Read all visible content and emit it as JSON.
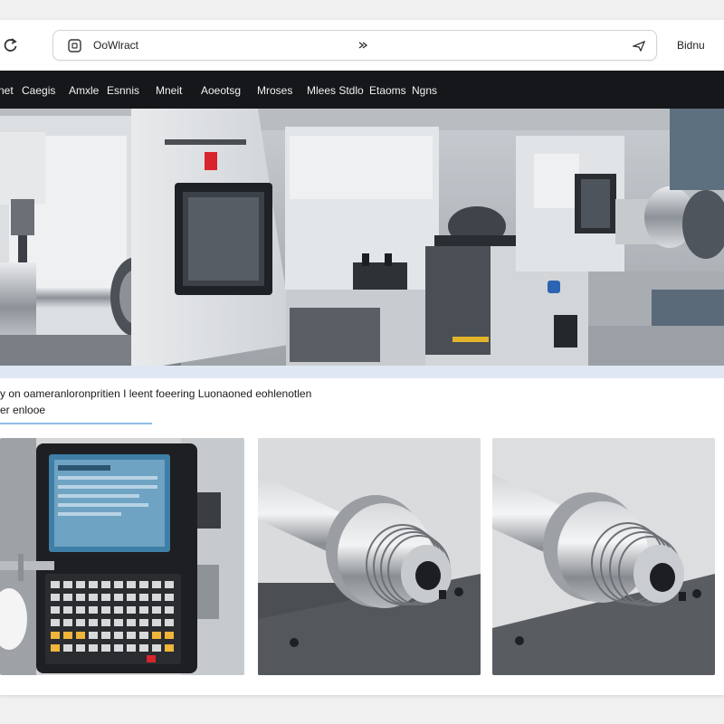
{
  "browser": {
    "url_text": "OoWlract",
    "right_label": "Bidnu"
  },
  "nav": {
    "items": [
      "net",
      "Caegis",
      "Amxle",
      "Esnnis",
      "Mneit",
      "Aoeotsg",
      "Mroses",
      "Mlees Stdlo",
      "Etaoms",
      "Ngns"
    ]
  },
  "hero": {
    "alt": "CNC machining workshop with lathes"
  },
  "caption": {
    "line1": "y on oameranloronpritien I leent foeering Luonaoned eohlenotlen",
    "line2": "er enlooe"
  },
  "thumbnails": [
    {
      "alt": "CNC control panel with keypad"
    },
    {
      "alt": "Machined threaded shaft"
    },
    {
      "alt": "Machined threaded shaft close-up"
    }
  ],
  "colors": {
    "navbar_bg": "#15171a",
    "accent_underline": "#8fbde6",
    "status_red": "#d8242c"
  }
}
